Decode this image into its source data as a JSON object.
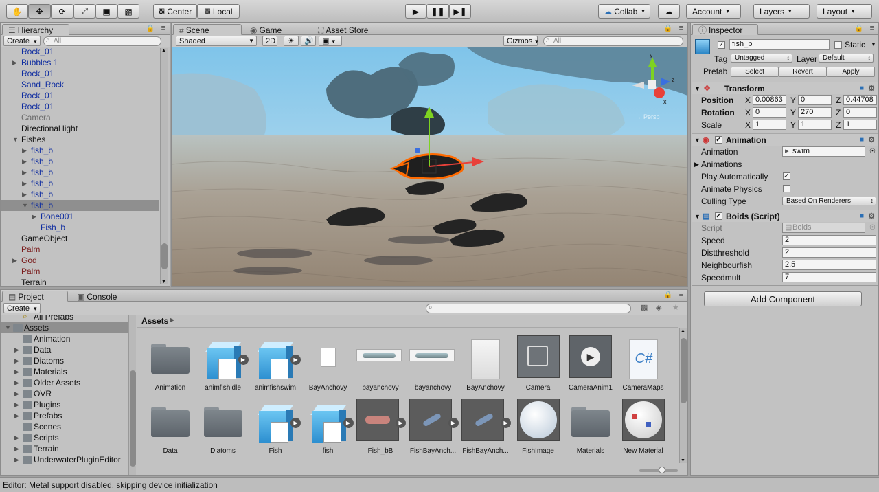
{
  "toolbar": {
    "center": "Center",
    "local": "Local",
    "collab": "Collab",
    "account": "Account",
    "layers": "Layers",
    "layout": "Layout"
  },
  "hierarchy": {
    "tab": "Hierarchy",
    "create": "Create",
    "search_placeholder": "All",
    "rows": [
      {
        "label": "Rock_01",
        "style": "pfb",
        "indent": 30,
        "arrow": ""
      },
      {
        "label": "Bubbles 1",
        "style": "pfb",
        "indent": 30,
        "arrow": "right"
      },
      {
        "label": "Rock_01",
        "style": "pfb",
        "indent": 30,
        "arrow": ""
      },
      {
        "label": "Sand_Rock",
        "style": "pfb",
        "indent": 30,
        "arrow": ""
      },
      {
        "label": "Rock_01",
        "style": "pfb",
        "indent": 30,
        "arrow": ""
      },
      {
        "label": "Rock_01",
        "style": "pfb",
        "indent": 30,
        "arrow": ""
      },
      {
        "label": "Camera",
        "style": "dis",
        "indent": 30,
        "arrow": ""
      },
      {
        "label": "Directional light",
        "style": "",
        "indent": 30,
        "arrow": ""
      },
      {
        "label": "Fishes",
        "style": "",
        "indent": 30,
        "arrow": "down"
      },
      {
        "label": "fish_b",
        "style": "pfb",
        "indent": 44,
        "arrow": "right"
      },
      {
        "label": "fish_b",
        "style": "pfb",
        "indent": 44,
        "arrow": "right"
      },
      {
        "label": "fish_b",
        "style": "pfb",
        "indent": 44,
        "arrow": "right"
      },
      {
        "label": "fish_b",
        "style": "pfb",
        "indent": 44,
        "arrow": "right"
      },
      {
        "label": "fish_b",
        "style": "pfb",
        "indent": 44,
        "arrow": "right"
      },
      {
        "label": "fish_b",
        "style": "pfb",
        "indent": 44,
        "arrow": "down",
        "selected": true
      },
      {
        "label": "Bone001",
        "style": "pfb",
        "indent": 58,
        "arrow": "right"
      },
      {
        "label": "Fish_b",
        "style": "pfb",
        "indent": 58,
        "arrow": ""
      },
      {
        "label": "GameObject",
        "style": "",
        "indent": 30,
        "arrow": ""
      },
      {
        "label": "Palm",
        "style": "pfr",
        "indent": 30,
        "arrow": ""
      },
      {
        "label": "God",
        "style": "pfr",
        "indent": 30,
        "arrow": "right"
      },
      {
        "label": "Palm",
        "style": "pfr",
        "indent": 30,
        "arrow": ""
      },
      {
        "label": "Terrain",
        "style": "",
        "indent": 30,
        "arrow": ""
      }
    ]
  },
  "scene": {
    "tabs": [
      "Scene",
      "Game",
      "Asset Store"
    ],
    "shading": "Shaded",
    "mode2d": "2D",
    "gizmos": "Gizmos",
    "search_placeholder": "All",
    "gizmo_axes": {
      "y": "y",
      "z": "z",
      "x": "x"
    },
    "persp": "←Persp"
  },
  "inspector": {
    "tab": "Inspector",
    "object_name": "fish_b",
    "static": "Static",
    "tag_label": "Tag",
    "tag_value": "Untagged",
    "layer_label": "Layer",
    "layer_value": "Default",
    "prefab_label": "Prefab",
    "prefab_select": "Select",
    "prefab_revert": "Revert",
    "prefab_apply": "Apply",
    "transform": {
      "title": "Transform",
      "position": {
        "label": "Position",
        "x": "0.00863",
        "y": "0",
        "z": "0.44708"
      },
      "rotation": {
        "label": "Rotation",
        "x": "0",
        "y": "270",
        "z": "0"
      },
      "scale": {
        "label": "Scale",
        "x": "1",
        "y": "1",
        "z": "1"
      }
    },
    "axis": {
      "x": "X",
      "y": "Y",
      "z": "Z"
    },
    "animation": {
      "title": "Animation",
      "animation_label": "Animation",
      "animation_value": "swim",
      "animations_label": "Animations",
      "play_auto_label": "Play Automatically",
      "play_auto": true,
      "physics_label": "Animate Physics",
      "physics": false,
      "culling_label": "Culling Type",
      "culling_value": "Based On Renderers"
    },
    "boids": {
      "title": "Boids (Script)",
      "script_label": "Script",
      "script_value": "Boids",
      "speed_label": "Speed",
      "speed": "2",
      "dist_label": "Distthreshold",
      "dist": "2",
      "neigh_label": "Neighbourfish",
      "neigh": "2.5",
      "speedmult_label": "Speedmult",
      "speedmult": "7"
    },
    "add_component": "Add Component"
  },
  "project": {
    "tabs": [
      "Project",
      "Console"
    ],
    "create": "Create",
    "breadcrumb": "Assets",
    "tree": [
      {
        "label": "All Prefabs",
        "indent": 48,
        "arrow": ""
      },
      {
        "label": "Assets",
        "indent": 34,
        "arrow": "down",
        "selected": true
      },
      {
        "label": "Animation",
        "indent": 48,
        "arrow": ""
      },
      {
        "label": "Data",
        "indent": 48,
        "arrow": "right"
      },
      {
        "label": "Diatoms",
        "indent": 48,
        "arrow": "right"
      },
      {
        "label": "Materials",
        "indent": 48,
        "arrow": "right"
      },
      {
        "label": "Older Assets",
        "indent": 48,
        "arrow": "right"
      },
      {
        "label": "OVR",
        "indent": 48,
        "arrow": "right"
      },
      {
        "label": "Plugins",
        "indent": 48,
        "arrow": "right"
      },
      {
        "label": "Prefabs",
        "indent": 48,
        "arrow": "right"
      },
      {
        "label": "Scenes",
        "indent": 48,
        "arrow": ""
      },
      {
        "label": "Scripts",
        "indent": 48,
        "arrow": "right"
      },
      {
        "label": "Terrain",
        "indent": 48,
        "arrow": "right"
      },
      {
        "label": "UnderwaterPluginEditor",
        "indent": 48,
        "arrow": "right"
      }
    ],
    "assets_row1": [
      {
        "label": "Animation",
        "kind": "folder"
      },
      {
        "label": "animfishidle",
        "kind": "cube",
        "play": true
      },
      {
        "label": "animfishswim",
        "kind": "cube",
        "play": true
      },
      {
        "label": "BayAnchovy",
        "kind": "smalldoc"
      },
      {
        "label": "bayanchovy",
        "kind": "texture"
      },
      {
        "label": "bayanchovy",
        "kind": "texture"
      },
      {
        "label": "BayAnchovy",
        "kind": "doc"
      },
      {
        "label": "Camera",
        "kind": "camera"
      },
      {
        "label": "CameraAnim1",
        "kind": "anim"
      },
      {
        "label": "CameraMaps",
        "kind": "cs"
      }
    ],
    "assets_row2": [
      {
        "label": "Data",
        "kind": "folder"
      },
      {
        "label": "Diatoms",
        "kind": "folder"
      },
      {
        "label": "Fish",
        "kind": "cube",
        "play": true
      },
      {
        "label": "fish",
        "kind": "cube",
        "play": true
      },
      {
        "label": "Fish_bB",
        "kind": "fishthumb",
        "play": true
      },
      {
        "label": "FishBayAnch...",
        "kind": "fishthumb2",
        "play": true
      },
      {
        "label": "FishBayAnch...",
        "kind": "fishthumb2",
        "play": true
      },
      {
        "label": "FishImage",
        "kind": "sphere"
      },
      {
        "label": "Materials",
        "kind": "folder"
      },
      {
        "label": "New Material",
        "kind": "material"
      }
    ]
  },
  "status": "Editor: Metal support disabled, skipping device initialization",
  "colors": {
    "prefab_blue": "#0f2da0",
    "prefab_red": "#7a1c1c",
    "selection": "#8f8f8f",
    "selected_outline": "#ff6a00"
  }
}
